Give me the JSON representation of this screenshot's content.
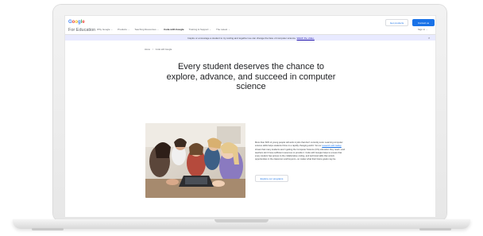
{
  "header": {
    "logo_letters": [
      {
        "ch": "G",
        "color": "#4285f4"
      },
      {
        "ch": "o",
        "color": "#ea4335"
      },
      {
        "ch": "o",
        "color": "#fbbc05"
      },
      {
        "ch": "g",
        "color": "#4285f4"
      },
      {
        "ch": "l",
        "color": "#34a853"
      },
      {
        "ch": "e",
        "color": "#ea4335"
      }
    ],
    "subtitle": "For Education",
    "nav": [
      {
        "label": "Why Google",
        "has_menu": true
      },
      {
        "label": "Products",
        "has_menu": true
      },
      {
        "label": "Teaching Resources",
        "has_menu": true
      },
      {
        "label": "Code with Google",
        "has_menu": false,
        "active": true
      },
      {
        "label": "Training & Support",
        "has_menu": true
      },
      {
        "label": "The Latest",
        "has_menu": true
      }
    ],
    "get_products_label": "Get products",
    "contact_label": "Contact us",
    "sign_in_label": "Sign in",
    "accent_color": "#1a73e8"
  },
  "banner": {
    "text": "Inspire or encourage a student to try coding and together we can change the face of computer science.",
    "link_text": "Watch the video.",
    "close_glyph": "×"
  },
  "breadcrumb": [
    "Home",
    "Code with Google"
  ],
  "hero": {
    "title": "Every student deserves the chance to explore, advance, and succeed in computer science"
  },
  "intro": {
    "text_before_link": "More than 60% of young people will work in jobs that don't currently exist. Learning computer science skills helps students thrive in a rapidly changing world. Yet our",
    "link_text": "research with Gallup",
    "text_after_link": "shows that many students aren't getting the Computer Science (CS) education they need—and teachers don't have sufficient resources to provide it. Code with Google helps to ensure that every student has access to the collaborative coding, and technical skills that unlock opportunities in the classroom and beyond—no matter what their future goals may be.",
    "button_label": "Explore our programs"
  }
}
